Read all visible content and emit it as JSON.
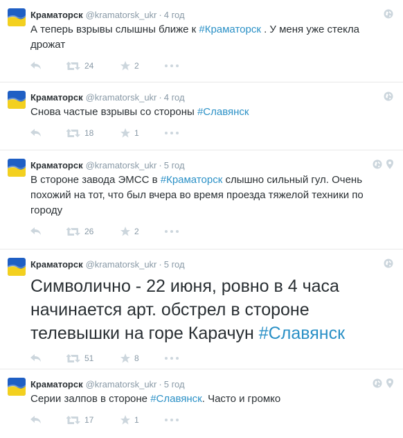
{
  "tweets": [
    {
      "name": "Краматорск",
      "handle": "@kramatorsk_ukr",
      "time": "4 год",
      "text_before": "А теперь взрывы слышны ближе к ",
      "hashtag": "#Краматорск",
      "text_after": " . У меня уже стекла дрожат",
      "retweets": "24",
      "favorites": "2",
      "has_location": false,
      "big": false
    },
    {
      "name": "Краматорск",
      "handle": "@kramatorsk_ukr",
      "time": "4 год",
      "text_before": "Снова частые взрывы со стороны ",
      "hashtag": "#Славянск",
      "text_after": "",
      "retweets": "18",
      "favorites": "1",
      "has_location": false,
      "big": false
    },
    {
      "name": "Краматорск",
      "handle": "@kramatorsk_ukr",
      "time": "5 год",
      "text_before": "В стороне завода ЭМСС в ",
      "hashtag": "#Краматорск",
      "text_after": " слышно сильный гул. Очень похожий на тот, что был вчера во время проезда тяжелой техники по городу",
      "retweets": "26",
      "favorites": "2",
      "has_location": true,
      "big": false
    },
    {
      "name": "Краматорск",
      "handle": "@kramatorsk_ukr",
      "time": "5 год",
      "text_before": "Символично - 22 июня, ровно в 4 часа начинается арт. обстрел в стороне телевышки на горе Карачун ",
      "hashtag": "#Славянск",
      "text_after": "",
      "retweets": "51",
      "favorites": "8",
      "has_location": false,
      "big": true
    },
    {
      "name": "Краматорск",
      "handle": "@kramatorsk_ukr",
      "time": "5 год",
      "text_before": "Серии залпов в стороне ",
      "hashtag": "#Славянск",
      "text_after": ". Часто и громко",
      "retweets": "17",
      "favorites": "1",
      "has_location": true,
      "big": false
    }
  ],
  "separator": "·",
  "colors": {
    "hashtag": "#2a90c6",
    "meta": "#8899a6",
    "icon": "#a9b4bc",
    "flag_blue": "#1f5fc4",
    "flag_yellow": "#f3d01f"
  },
  "icons": {
    "reply": "reply-icon",
    "retweet": "retweet-icon",
    "favorite": "star-icon",
    "more": "more-icon",
    "globe": "globe-icon",
    "location": "location-pin-icon"
  }
}
